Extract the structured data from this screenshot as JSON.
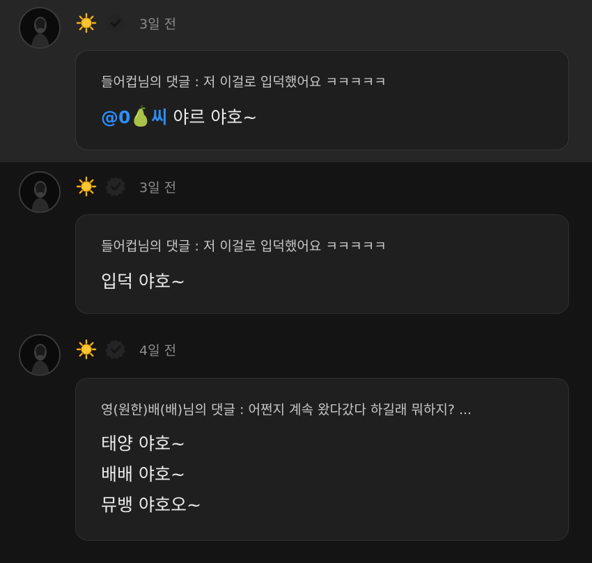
{
  "comments": [
    {
      "time": "3일 전",
      "reply_ref": "들어컵님의 댓글 : 저 이걸로 입덕했어요 ㅋㅋㅋㅋㅋ",
      "mention_a": "@0",
      "mention_b": "씨",
      "lines": [
        "야르 야호~"
      ]
    },
    {
      "time": "3일 전",
      "reply_ref": "들어컵님의 댓글 : 저 이걸로 입덕했어요 ㅋㅋㅋㅋㅋ",
      "lines": [
        "입덕 야호~"
      ]
    },
    {
      "time": "4일 전",
      "reply_ref": "영(원한)배(배)님의 댓글 : 어쩐지 계속 왔다갔다 하길래 뭐하지? ...",
      "lines": [
        "태양 야호~",
        "배배 야호~",
        "뮤뱅 야호오~"
      ]
    }
  ],
  "icons": {
    "badge": "sun-icon",
    "verified": "verified-check-icon",
    "mention_emoji": "pear-icon"
  },
  "colors": {
    "mention": "#2b8fff",
    "sun": "#f6b21b",
    "pear": "#a9c24a"
  }
}
